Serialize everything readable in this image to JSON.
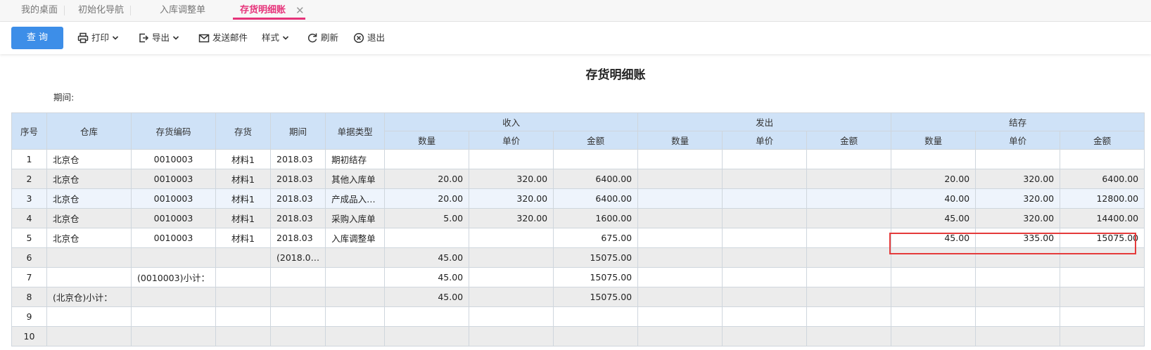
{
  "tabs": [
    {
      "label": "我的桌面"
    },
    {
      "label": "初始化导航"
    },
    {
      "label": "入库调整单"
    },
    {
      "label": "存货明细账",
      "active": true
    }
  ],
  "tab_close": "✕",
  "toolbar": {
    "query": "查 询",
    "print": "打印",
    "export": "导出",
    "email": "发送邮件",
    "style": "样式",
    "refresh": "刷新",
    "exit": "退出"
  },
  "report": {
    "title": "存货明细账",
    "period_label": "期间:"
  },
  "table": {
    "headers": {
      "seq": "序号",
      "warehouse": "仓库",
      "item_code": "存货编码",
      "item": "存货",
      "period": "期间",
      "doc_type": "单据类型",
      "in": "收入",
      "out": "发出",
      "balance": "结存",
      "qty": "数量",
      "price": "单价",
      "amount": "金额"
    },
    "rows": [
      {
        "seq": "1",
        "warehouse": "北京仓",
        "code": "0010003",
        "item": "材料1",
        "period": "2018.03",
        "doc": "期初结存",
        "in_qty": "",
        "in_price": "",
        "in_amt": "",
        "out_qty": "",
        "out_price": "",
        "out_amt": "",
        "bal_qty": "",
        "bal_price": "",
        "bal_amt": ""
      },
      {
        "seq": "2",
        "warehouse": "北京仓",
        "code": "0010003",
        "item": "材料1",
        "period": "2018.03",
        "doc": "其他入库单",
        "in_qty": "20.00",
        "in_price": "320.00",
        "in_amt": "6400.00",
        "out_qty": "",
        "out_price": "",
        "out_amt": "",
        "bal_qty": "20.00",
        "bal_price": "320.00",
        "bal_amt": "6400.00"
      },
      {
        "seq": "3",
        "warehouse": "北京仓",
        "code": "0010003",
        "item": "材料1",
        "period": "2018.03",
        "doc": "产成品入…",
        "in_qty": "20.00",
        "in_price": "320.00",
        "in_amt": "6400.00",
        "out_qty": "",
        "out_price": "",
        "out_amt": "",
        "bal_qty": "40.00",
        "bal_price": "320.00",
        "bal_amt": "12800.00"
      },
      {
        "seq": "4",
        "warehouse": "北京仓",
        "code": "0010003",
        "item": "材料1",
        "period": "2018.03",
        "doc": "采购入库单",
        "in_qty": "5.00",
        "in_price": "320.00",
        "in_amt": "1600.00",
        "out_qty": "",
        "out_price": "",
        "out_amt": "",
        "bal_qty": "45.00",
        "bal_price": "320.00",
        "bal_amt": "14400.00"
      },
      {
        "seq": "5",
        "warehouse": "北京仓",
        "code": "0010003",
        "item": "材料1",
        "period": "2018.03",
        "doc": "入库调整单",
        "in_qty": "",
        "in_price": "",
        "in_amt": "675.00",
        "out_qty": "",
        "out_price": "",
        "out_amt": "",
        "bal_qty": "45.00",
        "bal_price": "335.00",
        "bal_amt": "15075.00"
      },
      {
        "seq": "6",
        "warehouse": "",
        "code": "",
        "item": "",
        "period": "(2018.0…",
        "doc": "",
        "in_qty": "45.00",
        "in_price": "",
        "in_amt": "15075.00",
        "out_qty": "",
        "out_price": "",
        "out_amt": "",
        "bal_qty": "",
        "bal_price": "",
        "bal_amt": ""
      },
      {
        "seq": "7",
        "warehouse": "",
        "code": "(0010003)小计：",
        "item": "",
        "period": "",
        "doc": "",
        "in_qty": "45.00",
        "in_price": "",
        "in_amt": "15075.00",
        "out_qty": "",
        "out_price": "",
        "out_amt": "",
        "bal_qty": "",
        "bal_price": "",
        "bal_amt": ""
      },
      {
        "seq": "8",
        "warehouse": "(北京仓)小计：",
        "code": "",
        "item": "",
        "period": "",
        "doc": "",
        "in_qty": "45.00",
        "in_price": "",
        "in_amt": "15075.00",
        "out_qty": "",
        "out_price": "",
        "out_amt": "",
        "bal_qty": "",
        "bal_price": "",
        "bal_amt": ""
      },
      {
        "seq": "9",
        "warehouse": "",
        "code": "",
        "item": "",
        "period": "",
        "doc": "",
        "in_qty": "",
        "in_price": "",
        "in_amt": "",
        "out_qty": "",
        "out_price": "",
        "out_amt": "",
        "bal_qty": "",
        "bal_price": "",
        "bal_amt": ""
      },
      {
        "seq": "10",
        "warehouse": "",
        "code": "",
        "item": "",
        "period": "",
        "doc": "",
        "in_qty": "",
        "in_price": "",
        "in_amt": "",
        "out_qty": "",
        "out_price": "",
        "out_amt": "",
        "bal_qty": "",
        "bal_price": "",
        "bal_amt": ""
      }
    ]
  },
  "colors": {
    "accent_tab": "#e6337a",
    "query_button": "#3d8ee8",
    "header_bg": "#cfe2f7",
    "highlight_box": "#e53b3b",
    "link": "#1a1acd"
  }
}
